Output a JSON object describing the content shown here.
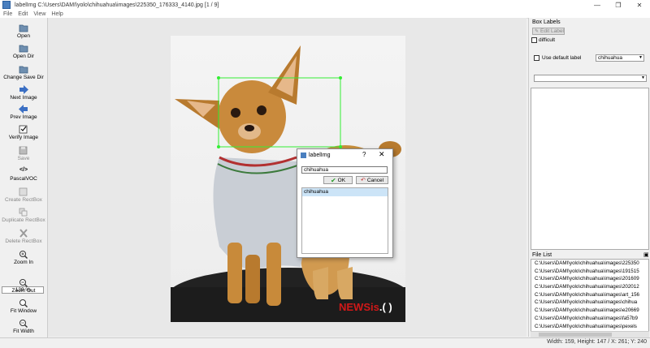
{
  "window": {
    "title": "labelImg C:\\Users\\DAMI\\yolo\\chihuahua\\images\\225350_176333_4140.jpg [1 / 9]",
    "minimize": "—",
    "maximize": "❐",
    "close": "✕"
  },
  "menu": [
    "File",
    "Edit",
    "View",
    "Help"
  ],
  "toolbar": {
    "open": "Open",
    "open_dir": "Open Dir",
    "change_save_dir": "Change Save Dir",
    "next_image": "Next Image",
    "prev_image": "Prev Image",
    "verify_image": "Verify Image",
    "save": "Save",
    "format": "PascalVOC",
    "create_rectbox": "Create RectBox",
    "duplicate_rectbox": "Duplicate RectBox",
    "delete_rectbox": "Delete RectBox",
    "zoom_in": "Zoom In",
    "zoom_value": "139 %",
    "zoom_out": "Zoom Out",
    "fit_window": "Fit Window",
    "fit_width": "Fit Width"
  },
  "photo": {
    "watermark_news": "NEWSis",
    "watermark_suffix": ".( )"
  },
  "dialog": {
    "title": "labelImg",
    "help": "?",
    "close": "✕",
    "input_value": "chihuahua",
    "ok_label": "OK",
    "cancel_label": "Cancel",
    "list_items": [
      "chihuahua"
    ]
  },
  "right_panel": {
    "box_labels_title": "Box Labels",
    "edit_label": "Edit Label",
    "difficult": "difficult",
    "use_default_label": "Use default label",
    "default_label_value": "chihuahua",
    "file_list_title": "File List",
    "files": [
      "C:\\Users\\DAMI\\yolo\\chihuahua\\images\\225350",
      "C:\\Users\\DAMI\\yolo\\chihuahua\\images\\191515",
      "C:\\Users\\DAMI\\yolo\\chihuahua\\images\\201609",
      "C:\\Users\\DAMI\\yolo\\chihuahua\\images\\202012",
      "C:\\Users\\DAMI\\yolo\\chihuahua\\images\\art_156",
      "C:\\Users\\DAMI\\yolo\\chihuahua\\images\\chihua",
      "C:\\Users\\DAMI\\yolo\\chihuahua\\images\\e20669",
      "C:\\Users\\DAMI\\yolo\\chihuahua\\images\\fa57b9",
      "C:\\Users\\DAMI\\yolo\\chihuahua\\images\\pexels"
    ]
  },
  "status": "Width: 159, Height: 147 / X: 261; Y: 240",
  "colors": {
    "bbox_green": "#33ee33",
    "list_selection": "#cce4f7",
    "watermark_red": "#d01818"
  }
}
